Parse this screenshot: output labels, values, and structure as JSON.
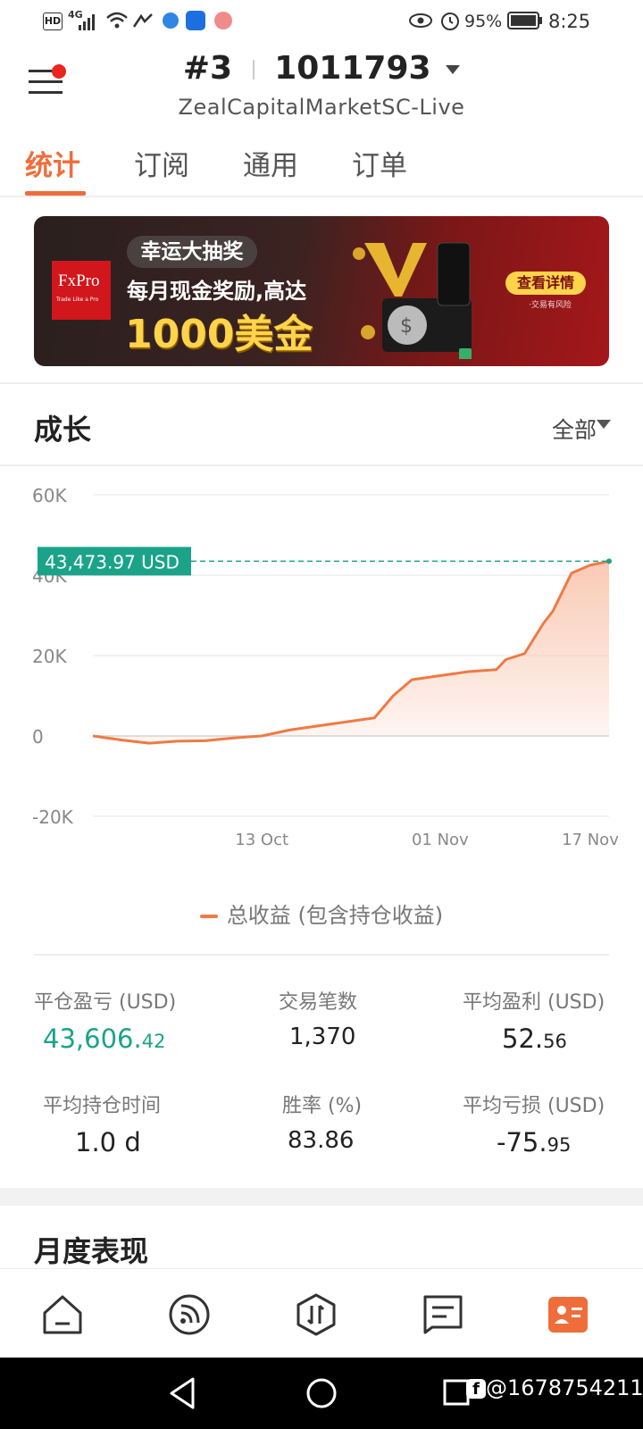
{
  "status_bar": {
    "hd": "HD",
    "network": "4G",
    "battery": "95%",
    "time": "8:25"
  },
  "header": {
    "account_num": "#3",
    "account_id": "1011793",
    "server": "ZealCapitalMarketSC-Live"
  },
  "tabs": [
    {
      "label": "统计"
    },
    {
      "label": "订阅"
    },
    {
      "label": "通用"
    },
    {
      "label": "订单"
    }
  ],
  "banner": {
    "logo": "FxPro",
    "logo_tagline": "Trade Like a Pro",
    "pill": "幸运大抽奖",
    "line2": "每月现金奖励,高达",
    "line3": "1000美金",
    "button": "查看详情",
    "risk_note": "·交易有风险"
  },
  "growth": {
    "title": "成长",
    "range": "全部"
  },
  "chart_data": {
    "type": "area",
    "y_ticks": [
      "60K",
      "40K",
      "20K",
      "0",
      "-20K"
    ],
    "ylim": [
      -20000,
      60000
    ],
    "x_ticks": [
      "13 Oct",
      "01 Nov",
      "17 Nov"
    ],
    "x": [
      "Sep 25",
      "Sep 28",
      "Oct 1",
      "Oct 4",
      "Oct 7",
      "Oct 10",
      "Oct 13",
      "Oct 16",
      "Oct 19",
      "Oct 22",
      "Oct 25",
      "Oct 27",
      "Oct 29",
      "Nov 1",
      "Nov 4",
      "Nov 7",
      "Nov 8",
      "Nov 10",
      "Nov 12",
      "Nov 13",
      "Nov 15",
      "Nov 17",
      "Nov 19"
    ],
    "series": [
      {
        "name": "总收益 (包含持仓收益)",
        "values": [
          0,
          -1000,
          -1800,
          -1300,
          -1200,
          -500,
          0,
          1500,
          2500,
          3500,
          4500,
          10000,
          14000,
          15000,
          16000,
          16500,
          19000,
          20500,
          28000,
          31000,
          40500,
          42500,
          43474
        ]
      }
    ],
    "current_value_label": "43,473.97 USD",
    "grid": true,
    "colors": {
      "line": "#ef7a45",
      "fill": "#f9c7b1",
      "marker": "#1aa389"
    }
  },
  "legend": {
    "label": "总收益 (包含持仓收益)"
  },
  "stats": [
    {
      "label": "平仓盈亏 (USD)",
      "int": "43,606.",
      "dec": "42",
      "highlight": true
    },
    {
      "label": "交易笔数",
      "int": "1,370",
      "dec": ""
    },
    {
      "label": "平均盈利 (USD)",
      "int": "52.",
      "dec": "56"
    },
    {
      "label": "平均持仓时间",
      "int": "1.0 d",
      "dec": ""
    },
    {
      "label": "胜率 (%)",
      "int": "83.86",
      "dec": ""
    },
    {
      "label": "平均亏损 (USD)",
      "int": "-75.",
      "dec": "95"
    }
  ],
  "monthly": {
    "title": "月度表现"
  },
  "watermark": "@1678754211",
  "icons": {
    "menu": "menu-icon",
    "home": "home-icon",
    "signal": "signal-icon",
    "trade": "trade-icon",
    "news": "news-icon",
    "profile": "profile-card-icon"
  }
}
